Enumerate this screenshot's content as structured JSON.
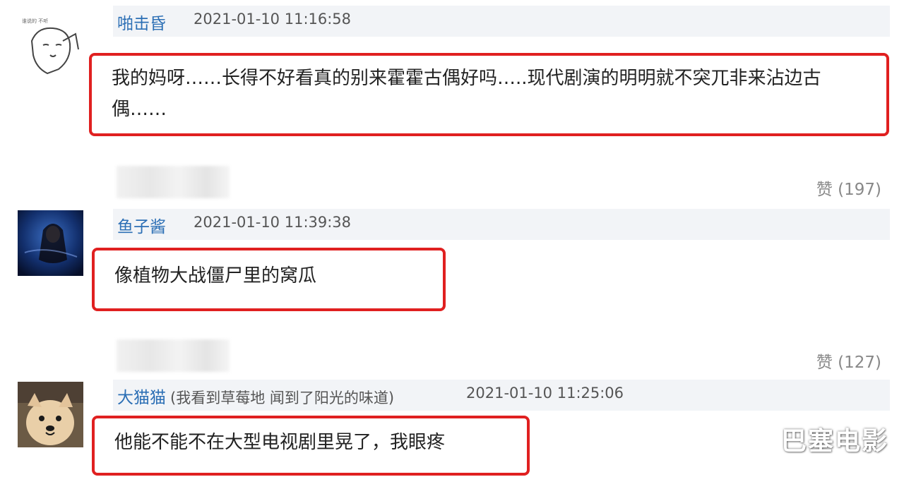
{
  "comments": [
    {
      "username": "啪击昏",
      "timestamp": "2021-01-10 11:16:58",
      "text_line1": "我的妈呀……长得不好看真的别来霍霍古偶好吗…..现代剧演的明明就不突兀非来沾边古",
      "text_line2": "偶……",
      "likes": "赞 (197)"
    },
    {
      "username": "鱼子酱",
      "timestamp": "2021-01-10 11:39:38",
      "text": "像植物大战僵尸里的窝瓜",
      "likes": "赞 (127)"
    },
    {
      "username": "大猫猫",
      "user_note": "(我看到草莓地 闻到了阳光的味道)",
      "timestamp": "2021-01-10 11:25:06",
      "text": "他能不能不在大型电视剧里晃了，我眼疼"
    }
  ],
  "watermark": "巴塞电影",
  "colors": {
    "username": "#2c6fb5",
    "highlight_border": "#e02020",
    "header_bg": "#f2f4f7"
  }
}
